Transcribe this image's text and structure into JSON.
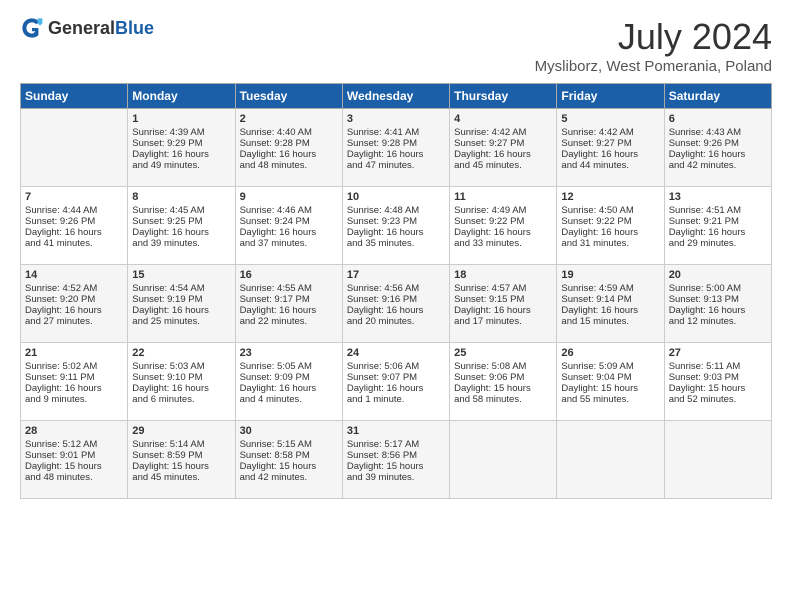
{
  "header": {
    "logo_general": "General",
    "logo_blue": "Blue",
    "title": "July 2024",
    "location": "Mysliborz, West Pomerania, Poland"
  },
  "weekdays": [
    "Sunday",
    "Monday",
    "Tuesday",
    "Wednesday",
    "Thursday",
    "Friday",
    "Saturday"
  ],
  "weeks": [
    [
      {
        "day": "",
        "text": ""
      },
      {
        "day": "1",
        "text": "Sunrise: 4:39 AM\nSunset: 9:29 PM\nDaylight: 16 hours\nand 49 minutes."
      },
      {
        "day": "2",
        "text": "Sunrise: 4:40 AM\nSunset: 9:28 PM\nDaylight: 16 hours\nand 48 minutes."
      },
      {
        "day": "3",
        "text": "Sunrise: 4:41 AM\nSunset: 9:28 PM\nDaylight: 16 hours\nand 47 minutes."
      },
      {
        "day": "4",
        "text": "Sunrise: 4:42 AM\nSunset: 9:27 PM\nDaylight: 16 hours\nand 45 minutes."
      },
      {
        "day": "5",
        "text": "Sunrise: 4:42 AM\nSunset: 9:27 PM\nDaylight: 16 hours\nand 44 minutes."
      },
      {
        "day": "6",
        "text": "Sunrise: 4:43 AM\nSunset: 9:26 PM\nDaylight: 16 hours\nand 42 minutes."
      }
    ],
    [
      {
        "day": "7",
        "text": "Sunrise: 4:44 AM\nSunset: 9:26 PM\nDaylight: 16 hours\nand 41 minutes."
      },
      {
        "day": "8",
        "text": "Sunrise: 4:45 AM\nSunset: 9:25 PM\nDaylight: 16 hours\nand 39 minutes."
      },
      {
        "day": "9",
        "text": "Sunrise: 4:46 AM\nSunset: 9:24 PM\nDaylight: 16 hours\nand 37 minutes."
      },
      {
        "day": "10",
        "text": "Sunrise: 4:48 AM\nSunset: 9:23 PM\nDaylight: 16 hours\nand 35 minutes."
      },
      {
        "day": "11",
        "text": "Sunrise: 4:49 AM\nSunset: 9:22 PM\nDaylight: 16 hours\nand 33 minutes."
      },
      {
        "day": "12",
        "text": "Sunrise: 4:50 AM\nSunset: 9:22 PM\nDaylight: 16 hours\nand 31 minutes."
      },
      {
        "day": "13",
        "text": "Sunrise: 4:51 AM\nSunset: 9:21 PM\nDaylight: 16 hours\nand 29 minutes."
      }
    ],
    [
      {
        "day": "14",
        "text": "Sunrise: 4:52 AM\nSunset: 9:20 PM\nDaylight: 16 hours\nand 27 minutes."
      },
      {
        "day": "15",
        "text": "Sunrise: 4:54 AM\nSunset: 9:19 PM\nDaylight: 16 hours\nand 25 minutes."
      },
      {
        "day": "16",
        "text": "Sunrise: 4:55 AM\nSunset: 9:17 PM\nDaylight: 16 hours\nand 22 minutes."
      },
      {
        "day": "17",
        "text": "Sunrise: 4:56 AM\nSunset: 9:16 PM\nDaylight: 16 hours\nand 20 minutes."
      },
      {
        "day": "18",
        "text": "Sunrise: 4:57 AM\nSunset: 9:15 PM\nDaylight: 16 hours\nand 17 minutes."
      },
      {
        "day": "19",
        "text": "Sunrise: 4:59 AM\nSunset: 9:14 PM\nDaylight: 16 hours\nand 15 minutes."
      },
      {
        "day": "20",
        "text": "Sunrise: 5:00 AM\nSunset: 9:13 PM\nDaylight: 16 hours\nand 12 minutes."
      }
    ],
    [
      {
        "day": "21",
        "text": "Sunrise: 5:02 AM\nSunset: 9:11 PM\nDaylight: 16 hours\nand 9 minutes."
      },
      {
        "day": "22",
        "text": "Sunrise: 5:03 AM\nSunset: 9:10 PM\nDaylight: 16 hours\nand 6 minutes."
      },
      {
        "day": "23",
        "text": "Sunrise: 5:05 AM\nSunset: 9:09 PM\nDaylight: 16 hours\nand 4 minutes."
      },
      {
        "day": "24",
        "text": "Sunrise: 5:06 AM\nSunset: 9:07 PM\nDaylight: 16 hours\nand 1 minute."
      },
      {
        "day": "25",
        "text": "Sunrise: 5:08 AM\nSunset: 9:06 PM\nDaylight: 15 hours\nand 58 minutes."
      },
      {
        "day": "26",
        "text": "Sunrise: 5:09 AM\nSunset: 9:04 PM\nDaylight: 15 hours\nand 55 minutes."
      },
      {
        "day": "27",
        "text": "Sunrise: 5:11 AM\nSunset: 9:03 PM\nDaylight: 15 hours\nand 52 minutes."
      }
    ],
    [
      {
        "day": "28",
        "text": "Sunrise: 5:12 AM\nSunset: 9:01 PM\nDaylight: 15 hours\nand 48 minutes."
      },
      {
        "day": "29",
        "text": "Sunrise: 5:14 AM\nSunset: 8:59 PM\nDaylight: 15 hours\nand 45 minutes."
      },
      {
        "day": "30",
        "text": "Sunrise: 5:15 AM\nSunset: 8:58 PM\nDaylight: 15 hours\nand 42 minutes."
      },
      {
        "day": "31",
        "text": "Sunrise: 5:17 AM\nSunset: 8:56 PM\nDaylight: 15 hours\nand 39 minutes."
      },
      {
        "day": "",
        "text": ""
      },
      {
        "day": "",
        "text": ""
      },
      {
        "day": "",
        "text": ""
      }
    ]
  ]
}
